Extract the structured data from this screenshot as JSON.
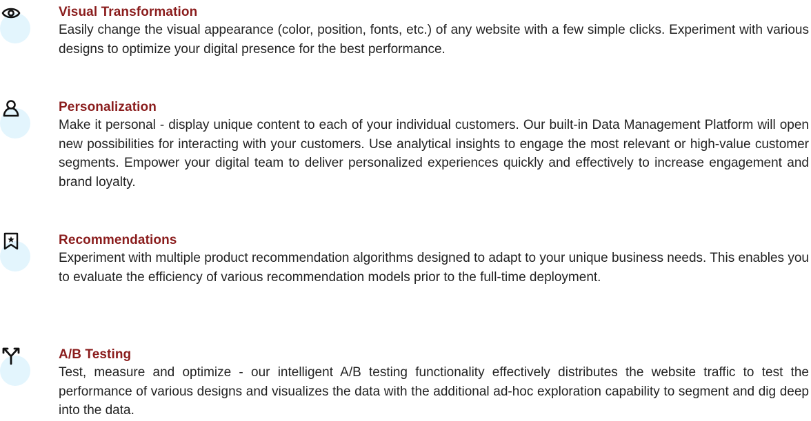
{
  "features": [
    {
      "icon": "eye-icon",
      "title": "Visual Transformation",
      "text": "Easily change the visual appearance (color, position, fonts, etc.) of any website with a few simple clicks. Experiment with various designs to optimize your digital presence for the best performance."
    },
    {
      "icon": "user-icon",
      "title": "Personalization",
      "text": "Make it personal - display unique content to each of your individual customers. Our built-in Data Management Platform will open new possibilities for interacting with your customers. Use analytical insights to engage the most relevant or high-value customer segments. Empower your digital team to deliver personalized experiences quickly and effectively to increase engagement and brand loyalty."
    },
    {
      "icon": "bookmark-star-icon",
      "title": "Recommendations",
      "text": "Experiment with multiple product recommendation algorithms designed to adapt to your unique business needs. This enables you to evaluate the efficiency of various recommendation models prior to the full-time deployment."
    },
    {
      "icon": "split-arrows-icon",
      "title": "A/B Testing",
      "text": "Test, measure and optimize - our intelligent A/B testing functionality effectively distributes the website traffic to test the performance of various designs and visualizes the data with the additional ad-hoc exploration capability to segment and dig deep into the data."
    }
  ],
  "colors": {
    "title": "#8a1c1c",
    "body_text": "#222222",
    "icon": "#111111",
    "icon_background": "#e3f5fd"
  }
}
